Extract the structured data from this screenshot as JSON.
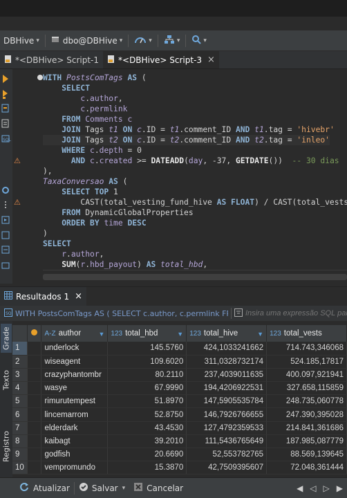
{
  "toolbar": {
    "datasource": "DBHive",
    "schema": "dbo@DBHive"
  },
  "tabs": [
    {
      "label": "*<DBHive> Script-1"
    },
    {
      "label": "*<DBHive> Script-3",
      "close": "×"
    }
  ],
  "code": [
    "WITH PostsComTags AS (",
    "    SELECT",
    "        c.author,",
    "        c.permlink",
    "    FROM Comments c",
    "    JOIN Tags t1 ON c.ID = t1.comment_ID AND t1.tag = 'hivebr'",
    "    JOIN Tags t2 ON c.ID = t2.comment_ID AND t2.tag = 'inleo'",
    "    WHERE c.depth = 0",
    "      AND c.created >= DATEADD(day, -37, GETDATE())  -- 30 dias",
    "),",
    "TaxaConversao AS (",
    "    SELECT TOP 1",
    "        CAST(total_vesting_fund_hive AS FLOAT) / CAST(total_vests",
    "    FROM DynamicGlobalProperties",
    "    ORDER BY time DESC",
    ")",
    "SELECT",
    "    r.author,",
    "    SUM(r.hbd_payout) AS total_hbd,"
  ],
  "results": {
    "tab_label": "Resultados 1",
    "filter_text": "WITH PostsComTags AS ( SELECT c.author, c.permlink FRC",
    "filter_placeholder": "Insira uma expressão SQL para filtrar",
    "columns": [
      {
        "type": "A-Z",
        "name": "author"
      },
      {
        "type": "123",
        "name": "total_hbd"
      },
      {
        "type": "123",
        "name": "total_hive"
      },
      {
        "type": "123",
        "name": "total_vests"
      }
    ],
    "rows": [
      {
        "n": "1",
        "author": "underlock",
        "hbd": "145.5760",
        "hive": "424,1033241662",
        "vests": "714.743,346068"
      },
      {
        "n": "2",
        "author": "wiseagent",
        "hbd": "109.6020",
        "hive": "311,0328732174",
        "vests": "524.185,17817"
      },
      {
        "n": "3",
        "author": "crazyphantombr",
        "hbd": "80.2110",
        "hive": "237,4039011635",
        "vests": "400.097,921941"
      },
      {
        "n": "4",
        "author": "wasye",
        "hbd": "67.9990",
        "hive": "194,4206922531",
        "vests": "327.658,115859"
      },
      {
        "n": "5",
        "author": "rimurutempest",
        "hbd": "51.8970",
        "hive": "147,5905535784",
        "vests": "248.735,060778"
      },
      {
        "n": "6",
        "author": "lincemarrom",
        "hbd": "52.8750",
        "hive": "146,7926766655",
        "vests": "247.390,395028"
      },
      {
        "n": "7",
        "author": "elderdark",
        "hbd": "43.4530",
        "hive": "127,4792359533",
        "vests": "214.841,361686"
      },
      {
        "n": "8",
        "author": "kaibagt",
        "hbd": "39.2010",
        "hive": "111,5436765649",
        "vests": "187.985,087779"
      },
      {
        "n": "9",
        "author": "godfish",
        "hbd": "20.6690",
        "hive": "52,553782765",
        "vests": "88.569,139645"
      },
      {
        "n": "10",
        "author": "vempromundo",
        "hbd": "15.3870",
        "hive": "42,7509395607",
        "vests": "72.048,361444"
      }
    ],
    "side_tabs": [
      "Grade",
      "Texto",
      "Registro"
    ]
  },
  "status": {
    "refresh": "Atualizar",
    "save": "Salvar",
    "cancel": "Cancelar"
  }
}
